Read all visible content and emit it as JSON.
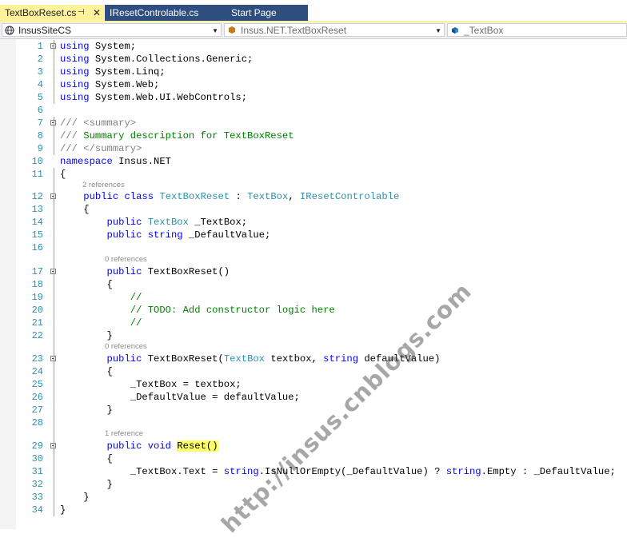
{
  "tabs": [
    {
      "label": "TextBoxReset.cs",
      "active": true
    },
    {
      "label": "IResetControlable.cs",
      "active": false
    },
    {
      "label": "Start Page",
      "active": false
    }
  ],
  "tab_pin_glyph": "⊣",
  "tab_close_glyph": "✕",
  "navbar": {
    "project": "InsusSiteCS",
    "type_scope": "Insus.NET.TextBoxReset",
    "member": "_TextBox"
  },
  "code_lines": [
    {
      "n": "1",
      "t": [
        [
          "kw",
          "using"
        ],
        [
          "p",
          " System;"
        ]
      ]
    },
    {
      "n": "2",
      "t": [
        [
          "kw",
          "using"
        ],
        [
          "p",
          " System.Collections.Generic;"
        ]
      ]
    },
    {
      "n": "3",
      "t": [
        [
          "kw",
          "using"
        ],
        [
          "p",
          " System.Linq;"
        ]
      ]
    },
    {
      "n": "4",
      "t": [
        [
          "kw",
          "using"
        ],
        [
          "p",
          " System.Web;"
        ]
      ]
    },
    {
      "n": "5",
      "t": [
        [
          "kw",
          "using"
        ],
        [
          "p",
          " System.Web.UI.WebControls;"
        ]
      ]
    },
    {
      "n": "6",
      "t": []
    },
    {
      "n": "7",
      "t": [
        [
          "dc",
          "/// "
        ],
        [
          "dc",
          "<summary>"
        ]
      ]
    },
    {
      "n": "8",
      "t": [
        [
          "dc",
          "/// "
        ],
        [
          "cm",
          "Summary description for TextBoxReset"
        ]
      ]
    },
    {
      "n": "9",
      "t": [
        [
          "dc",
          "/// "
        ],
        [
          "dc",
          "</summary>"
        ]
      ]
    },
    {
      "n": "10",
      "t": [
        [
          "kw",
          "namespace"
        ],
        [
          "p",
          " Insus.NET"
        ]
      ]
    },
    {
      "n": "11",
      "t": [
        [
          "p",
          "{"
        ]
      ]
    },
    {
      "n": "12",
      "t": [
        [
          "p",
          "    "
        ],
        [
          "kw",
          "public"
        ],
        [
          "p",
          " "
        ],
        [
          "kw",
          "class"
        ],
        [
          "p",
          " "
        ],
        [
          "ty",
          "TextBoxReset"
        ],
        [
          "p",
          " : "
        ],
        [
          "ty",
          "TextBox"
        ],
        [
          "p",
          ", "
        ],
        [
          "ty",
          "IResetControlable"
        ]
      ]
    },
    {
      "n": "13",
      "t": [
        [
          "p",
          "    {"
        ]
      ]
    },
    {
      "n": "14",
      "t": [
        [
          "p",
          "        "
        ],
        [
          "kw",
          "public"
        ],
        [
          "p",
          " "
        ],
        [
          "ty",
          "TextBox"
        ],
        [
          "p",
          " _TextBox;"
        ]
      ]
    },
    {
      "n": "15",
      "t": [
        [
          "p",
          "        "
        ],
        [
          "kw",
          "public"
        ],
        [
          "p",
          " "
        ],
        [
          "kw",
          "string"
        ],
        [
          "p",
          " _DefaultValue;"
        ]
      ]
    },
    {
      "n": "16",
      "t": []
    },
    {
      "n": "17",
      "t": [
        [
          "p",
          "        "
        ],
        [
          "kw",
          "public"
        ],
        [
          "p",
          " TextBoxReset()"
        ]
      ]
    },
    {
      "n": "18",
      "t": [
        [
          "p",
          "        {"
        ]
      ]
    },
    {
      "n": "19",
      "t": [
        [
          "p",
          "            "
        ],
        [
          "cm",
          "//"
        ]
      ]
    },
    {
      "n": "20",
      "t": [
        [
          "p",
          "            "
        ],
        [
          "cm",
          "// TODO: Add constructor logic here"
        ]
      ]
    },
    {
      "n": "21",
      "t": [
        [
          "p",
          "            "
        ],
        [
          "cm",
          "//"
        ]
      ]
    },
    {
      "n": "22",
      "t": [
        [
          "p",
          "        }"
        ]
      ]
    },
    {
      "n": "23",
      "t": [
        [
          "p",
          "        "
        ],
        [
          "kw",
          "public"
        ],
        [
          "p",
          " TextBoxReset("
        ],
        [
          "ty",
          "TextBox"
        ],
        [
          "p",
          " textbox, "
        ],
        [
          "kw",
          "string"
        ],
        [
          "p",
          " defaultValue)"
        ]
      ]
    },
    {
      "n": "24",
      "t": [
        [
          "p",
          "        {"
        ]
      ]
    },
    {
      "n": "25",
      "t": [
        [
          "p",
          "            _TextBox = textbox;"
        ]
      ]
    },
    {
      "n": "26",
      "t": [
        [
          "p",
          "            _DefaultValue = defaultValue;"
        ]
      ]
    },
    {
      "n": "27",
      "t": [
        [
          "p",
          "        }"
        ]
      ]
    },
    {
      "n": "28",
      "t": []
    },
    {
      "n": "29",
      "t": [
        [
          "p",
          "        "
        ],
        [
          "kw",
          "public"
        ],
        [
          "p",
          " "
        ],
        [
          "kw",
          "void"
        ],
        [
          "p",
          " "
        ],
        [
          "hl",
          "Reset()"
        ]
      ]
    },
    {
      "n": "30",
      "t": [
        [
          "p",
          "        {"
        ]
      ]
    },
    {
      "n": "31",
      "t": [
        [
          "p",
          "            _TextBox.Text = "
        ],
        [
          "kw",
          "string"
        ],
        [
          "p",
          ".IsNullOrEmpty(_DefaultValue) ? "
        ],
        [
          "kw",
          "string"
        ],
        [
          "p",
          ".Empty : _DefaultValue;"
        ]
      ]
    },
    {
      "n": "32",
      "t": [
        [
          "p",
          "        }"
        ]
      ]
    },
    {
      "n": "33",
      "t": [
        [
          "p",
          "    }"
        ]
      ]
    },
    {
      "n": "34",
      "t": [
        [
          "p",
          "}"
        ]
      ]
    }
  ],
  "references": [
    {
      "before_line": "12",
      "label": "2 references"
    },
    {
      "before_line": "17",
      "label": "0 references"
    },
    {
      "before_line": "23",
      "label": "0 references"
    },
    {
      "before_line": "29",
      "label": "1 reference"
    }
  ],
  "watermark": "http://insus.cnblogs.com",
  "colors": {
    "keyword": "#0000ff",
    "type": "#2b91af",
    "comment": "#008000",
    "doc": "#808080",
    "active_tab": "#fff29d",
    "tab_bar": "#2d4e7e"
  }
}
